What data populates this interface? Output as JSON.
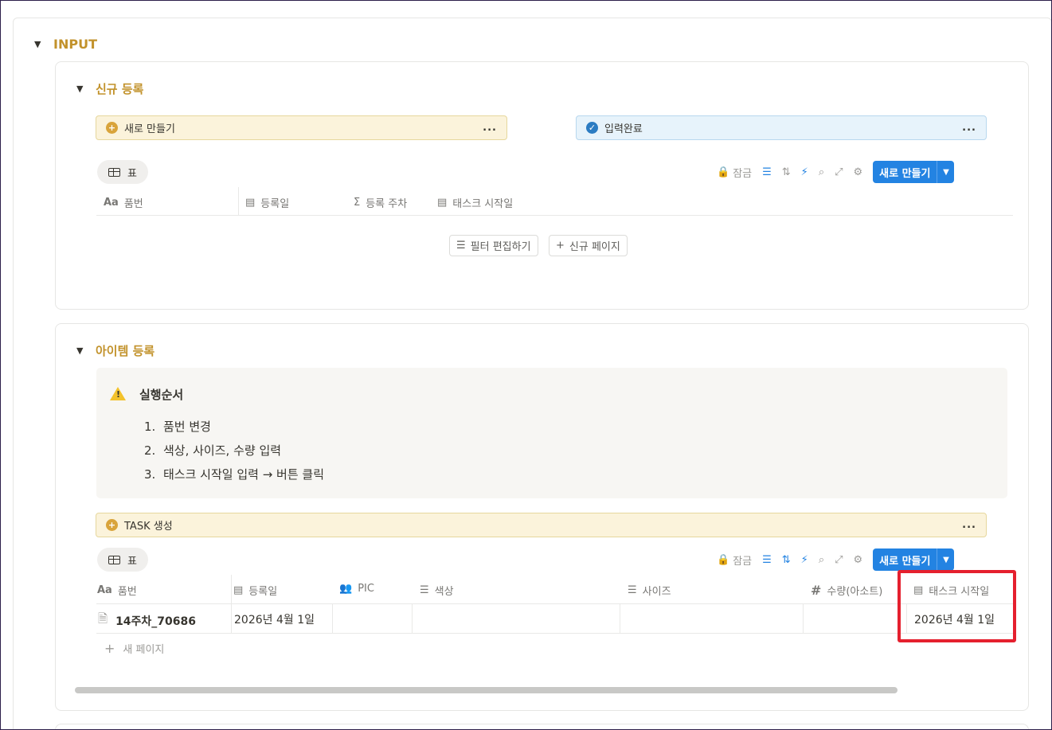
{
  "input_section": {
    "title": "INPUT"
  },
  "new_reg": {
    "title": "신규 등록",
    "create_button": {
      "label": "새로 만들기",
      "menu": "..."
    },
    "done_button": {
      "label": "입력완료",
      "menu": "..."
    },
    "view_tab": "표",
    "toolbar": {
      "lock": "잠금",
      "new": "새로 만들기"
    },
    "columns": [
      {
        "icon": "Aa",
        "label": "품번"
      },
      {
        "icon": "calendar-icon",
        "label": "등록일"
      },
      {
        "icon": "Σ",
        "label": "등록 주차"
      },
      {
        "icon": "calendar-icon",
        "label": "태스크 시작일"
      }
    ],
    "edit_filter": "필터 편집하기",
    "new_page": "신규 페이지"
  },
  "item_reg": {
    "title": "아이템 등록",
    "callout": {
      "icon": "warning-icon",
      "title": "실행순서",
      "steps": [
        {
          "num": "1.",
          "text": "품번 변경"
        },
        {
          "num": "2.",
          "text": "색상, 사이즈, 수량 입력"
        },
        {
          "num": "3.",
          "text": "태스크 시작일 입력 → 버튼 클릭"
        }
      ]
    },
    "task_button": {
      "label": "TASK 생성",
      "menu": "..."
    },
    "view_tab": "표",
    "toolbar": {
      "lock": "잠금",
      "new": "새로 만들기"
    },
    "columns": [
      {
        "icon": "Aa",
        "label": "품번"
      },
      {
        "icon": "calendar-icon",
        "label": "등록일"
      },
      {
        "icon": "people-icon",
        "label": "PIC"
      },
      {
        "icon": "list-icon",
        "label": "색상"
      },
      {
        "icon": "list-icon",
        "label": "사이즈"
      },
      {
        "icon": "#",
        "label": "수량(아소트)"
      },
      {
        "icon": "calendar-icon",
        "label": "태스크 시작일"
      }
    ],
    "row": {
      "name": "14주차_70686",
      "reg_date": "2026년 4월 1일",
      "task_start": "2026년 4월 1일"
    },
    "new_page": "새 페이지"
  },
  "colors": {
    "accent_gold": "#c2922b",
    "primary_blue": "#2383e2",
    "highlight_red": "#e5202e"
  }
}
